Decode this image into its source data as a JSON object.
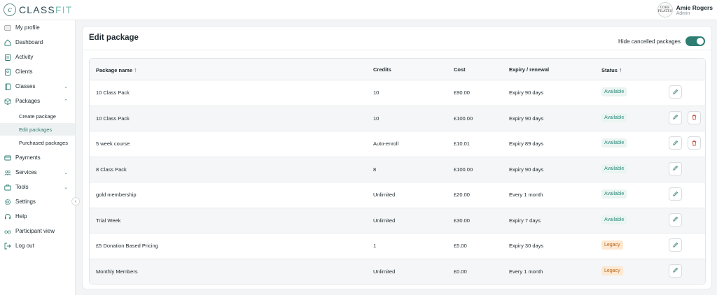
{
  "brand": {
    "logo_letter": "c",
    "name_part1": "CLASS",
    "name_part2": "FIT"
  },
  "user": {
    "name": "Amie Rogers",
    "role": "Admin",
    "avatar_text": "CORE PILATES"
  },
  "sidebar": {
    "items": [
      {
        "label": "My profile",
        "icon": "avatar-icon"
      },
      {
        "label": "Dashboard",
        "icon": "home-icon"
      },
      {
        "label": "Activity",
        "icon": "clipboard-icon"
      },
      {
        "label": "Clients",
        "icon": "clients-icon"
      },
      {
        "label": "Classes",
        "icon": "book-icon",
        "chevron": "down"
      },
      {
        "label": "Packages",
        "icon": "package-icon",
        "chevron": "up"
      },
      {
        "label": "Payments",
        "icon": "card-icon"
      },
      {
        "label": "Services",
        "icon": "services-icon",
        "chevron": "down"
      },
      {
        "label": "Tools",
        "icon": "toolbox-icon",
        "chevron": "down"
      },
      {
        "label": "Settings",
        "icon": "gear-icon"
      },
      {
        "label": "Help",
        "icon": "headset-icon"
      },
      {
        "label": "Participant view",
        "icon": "glasses-icon"
      },
      {
        "label": "Log out",
        "icon": "logout-icon"
      }
    ],
    "sub_items": [
      {
        "label": "Create package",
        "active": false
      },
      {
        "label": "Edit packages",
        "active": true
      },
      {
        "label": "Purchased packages",
        "active": false
      }
    ]
  },
  "page": {
    "title": "Edit package",
    "toggle_label": "Hide cancelled packages",
    "toggle_on": true
  },
  "table": {
    "headers": {
      "name": "Package name",
      "credits": "Credits",
      "cost": "Cost",
      "expiry": "Expiry / renewal",
      "status": "Status"
    },
    "rows": [
      {
        "name": "10 Class Pack",
        "credits": "10",
        "cost": "£90.00",
        "expiry": "Expiry 90 days",
        "status": "Available",
        "deletable": false
      },
      {
        "name": "10 Class Pack",
        "credits": "10",
        "cost": "£100.00",
        "expiry": "Expiry 90 days",
        "status": "Available",
        "deletable": true
      },
      {
        "name": "5 week course",
        "credits": "Auto-enroll",
        "cost": "£10.01",
        "expiry": "Expiry 89 days",
        "status": "Available",
        "deletable": true
      },
      {
        "name": "8 Class Pack",
        "credits": "8",
        "cost": "£100.00",
        "expiry": "Expiry 90 days",
        "status": "Available",
        "deletable": false
      },
      {
        "name": "gold membership",
        "credits": "Unlimited",
        "cost": "£20.00",
        "expiry": "Every 1 month",
        "status": "Available",
        "deletable": false
      },
      {
        "name": "Trial Week",
        "credits": "Unlimited",
        "cost": "£30.00",
        "expiry": "Expiry 7 days",
        "status": "Available",
        "deletable": false
      },
      {
        "name": "£5 Donation Based Pricing",
        "credits": "1",
        "cost": "£5.00",
        "expiry": "Expiry 30 days",
        "status": "Legacy",
        "deletable": false
      },
      {
        "name": "Monthly Members",
        "credits": "Unlimited",
        "cost": "£0.00",
        "expiry": "Every 1 month",
        "status": "Legacy",
        "deletable": false
      }
    ]
  },
  "colors": {
    "accent": "#2f7d72",
    "available_bg": "#eaf5f2",
    "legacy_bg": "#fde8d2",
    "delete": "#c0392b"
  }
}
